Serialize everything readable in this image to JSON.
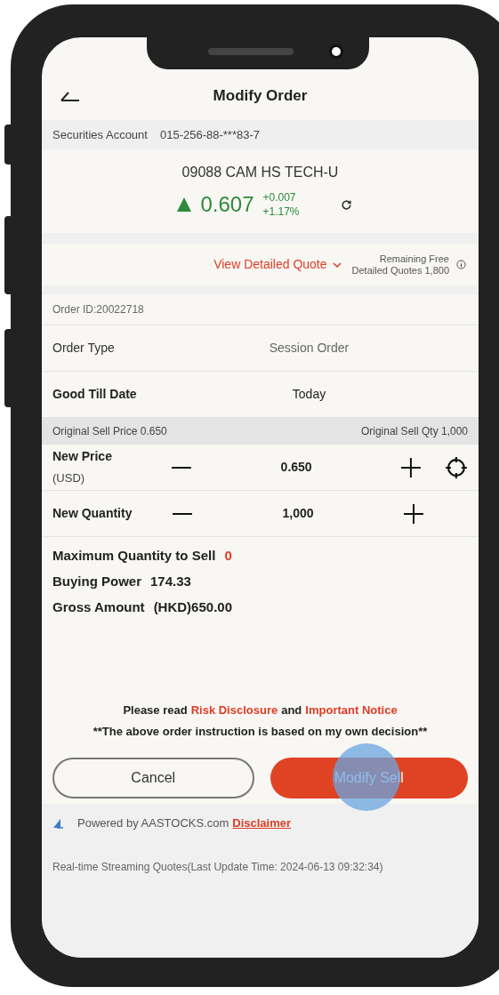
{
  "header": {
    "title": "Modify Order"
  },
  "account": {
    "label": "Securities Account",
    "value": "015-256-88-***83-7"
  },
  "quote": {
    "name": "09088 CAM HS TECH-U",
    "rising": true,
    "price": "0.607",
    "change": "+0.007",
    "change_pct": "+1.17%"
  },
  "detailed_quote": {
    "link": "View Detailed Quote",
    "remaining_line1": "Remaining Free",
    "remaining_line2": "Detailed Quotes 1,800"
  },
  "order_id": "Order ID:20022718",
  "fields": [
    {
      "label": "Order Type",
      "value": "Session Order",
      "bold": false
    },
    {
      "label": "Good Till Date",
      "value": "Today",
      "bold": true
    }
  ],
  "original": {
    "price": "Original Sell Price 0.650",
    "qty": "Original Sell Qty 1,000"
  },
  "steppers": [
    {
      "label": "New Price",
      "sublabel": "(USD)",
      "value": "0.650",
      "locate_button": true
    },
    {
      "label": "New Quantity",
      "value": "1,000",
      "locate_button": false
    }
  ],
  "summary": [
    {
      "label": "Maximum Quantity to Sell",
      "value": "0",
      "highlight": true
    },
    {
      "label": "Buying Power",
      "value": "174.33",
      "highlight": false
    },
    {
      "label": "Gross Amount",
      "value": "(HKD)650.00",
      "highlight": false
    }
  ],
  "notice": {
    "prefix": "Please read",
    "link1": "Risk Disclosure",
    "middle": "and",
    "link2": "Important Notice",
    "statement": "**The above order instruction is based on my own decision**"
  },
  "buttons": {
    "cancel": "Cancel",
    "submit": "Modify Sell"
  },
  "footer": {
    "powered": "Powered by AASTOCKS.com",
    "disclaimer": "Disclaimer",
    "streaming": "Real-time Streaming Quotes(Last Update Time: 2024-06-13 09:32:34)"
  }
}
